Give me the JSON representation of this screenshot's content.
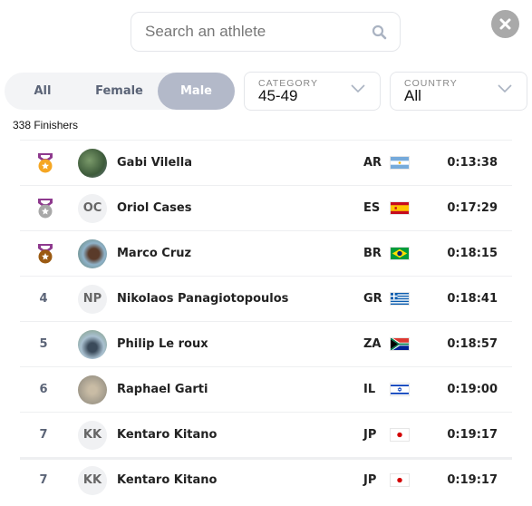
{
  "search": {
    "placeholder": "Search an athlete"
  },
  "gender_toggle": {
    "options": [
      "All",
      "Female",
      "Male"
    ],
    "selected": "Male"
  },
  "filters": {
    "category": {
      "label": "CATEGORY",
      "value": "45-49"
    },
    "country": {
      "label": "COUNTRY",
      "value": "All"
    }
  },
  "finishers": "338 Finishers",
  "colors": {
    "gold": "#f5a623",
    "silver": "#a8a8a8",
    "bronze": "#9b5a12",
    "ribbon": "#8e3a8e",
    "active_toggle": "#b3b9c9"
  },
  "results": [
    {
      "rank": "1",
      "medal": "gold",
      "initials": "",
      "photo": true,
      "name": "Gabi Vilella",
      "country": "AR",
      "time": "0:13:38"
    },
    {
      "rank": "2",
      "medal": "silver",
      "initials": "OC",
      "photo": false,
      "name": "Oriol Cases",
      "country": "ES",
      "time": "0:17:29"
    },
    {
      "rank": "3",
      "medal": "bronze",
      "initials": "",
      "photo": true,
      "name": "Marco Cruz",
      "country": "BR",
      "time": "0:18:15"
    },
    {
      "rank": "4",
      "medal": "",
      "initials": "NP",
      "photo": false,
      "name": "Nikolaos Panagiotopoulos",
      "country": "GR",
      "time": "0:18:41"
    },
    {
      "rank": "5",
      "medal": "",
      "initials": "",
      "photo": true,
      "name": "Philip Le roux",
      "country": "ZA",
      "time": "0:18:57"
    },
    {
      "rank": "6",
      "medal": "",
      "initials": "",
      "photo": true,
      "name": "Raphael Garti",
      "country": "IL",
      "time": "0:19:00"
    },
    {
      "rank": "7",
      "medal": "",
      "initials": "KK",
      "photo": false,
      "name": "Kentaro Kitano",
      "country": "JP",
      "time": "0:19:17"
    }
  ],
  "pinned_result": {
    "rank": "7",
    "medal": "",
    "initials": "KK",
    "photo": false,
    "name": "Kentaro Kitano",
    "country": "JP",
    "time": "0:19:17"
  }
}
